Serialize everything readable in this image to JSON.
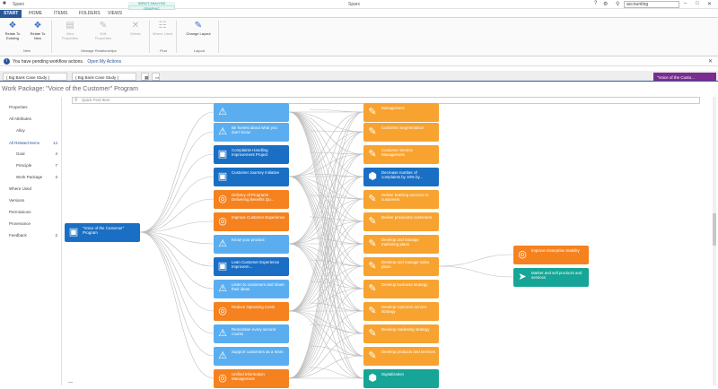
{
  "window": {
    "app_name": "Sparx",
    "center_title": "Sparx",
    "search_value": "accounting",
    "icons": [
      "help-icon",
      "settings-icon",
      "search-icon",
      "minimize-icon",
      "maximize-icon",
      "close-icon"
    ]
  },
  "ribbon_tabs": [
    "START",
    "HOME",
    "ITEMS",
    "FOLDERS",
    "VIEWS"
  ],
  "context_tab": {
    "header": "IMPACT ANALYSIS",
    "label": "GRAPHIC"
  },
  "ribbon": {
    "buttons": [
      {
        "label": "Relate To Existing",
        "icon": "relate-existing-icon",
        "enabled": true
      },
      {
        "label": "Relate To New",
        "icon": "relate-new-icon",
        "enabled": true
      },
      {
        "label": "View Properties",
        "icon": "view-properties-icon",
        "enabled": false
      },
      {
        "label": "Edit Properties",
        "icon": "edit-properties-icon",
        "enabled": false
      },
      {
        "label": "Delete",
        "icon": "delete-icon",
        "enabled": false
      },
      {
        "label": "Where Used",
        "icon": "where-used-icon",
        "enabled": false
      },
      {
        "label": "Change Layout",
        "icon": "change-layout-icon",
        "enabled": true
      }
    ],
    "groups": [
      "New",
      "Manage Relationships",
      "Find",
      "Layout"
    ]
  },
  "infobar": {
    "message": "You have pending workflow actions.",
    "link": "Open My Actions"
  },
  "doc_tabs": [
    {
      "label": "( Big Bank Case Study )",
      "active": false
    },
    {
      "label": "( Big Bank Case Study )",
      "active": false
    },
    {
      "label": "",
      "active": false
    },
    {
      "label": "",
      "active": false
    },
    {
      "label": "\"Voice of the Custo...",
      "active": true
    }
  ],
  "work_package_title": "Work Package: \"Voice of the Customer\" Program",
  "left_pane": [
    {
      "label": "Properties",
      "count": ""
    },
    {
      "label": "All Attributes",
      "count": ""
    },
    {
      "label": "Alloy",
      "count": ""
    },
    {
      "label": "All Related Items",
      "count": "14"
    },
    {
      "label": "Goal",
      "count": "4"
    },
    {
      "label": "Principle",
      "count": "7"
    },
    {
      "label": "Work Package",
      "count": "3"
    },
    {
      "label": "Where Used",
      "count": ""
    },
    {
      "label": "Versions",
      "count": ""
    },
    {
      "label": "Permissions",
      "count": ""
    },
    {
      "label": "Provenance",
      "count": ""
    },
    {
      "label": "Feedback",
      "count": "2"
    }
  ],
  "search_placeholder": "Quick Find Item",
  "diagram": {
    "root": {
      "label": "\"Voice of the Customer\" Program",
      "icon": "work-package-icon"
    },
    "column1": [
      {
        "label": "",
        "icon": "warning-icon",
        "color": "#5aaef0"
      },
      {
        "label": "Be honest about what you don't know",
        "icon": "warning-icon",
        "color": "#5aaef0"
      },
      {
        "label": "Complaints Handling Improvement Project",
        "icon": "work-package-icon",
        "color": "#1a6fc4"
      },
      {
        "label": "Customer Journey Initiative",
        "icon": "work-package-icon",
        "color": "#1a6fc4"
      },
      {
        "label": "Delivery of Programs Delivering Benefits Qu...",
        "icon": "goal-icon",
        "color": "#f5821f"
      },
      {
        "label": "Improve Customer Experience",
        "icon": "goal-icon",
        "color": "#f5821f"
      },
      {
        "label": "Know your product",
        "icon": "warning-icon",
        "color": "#5aaef0"
      },
      {
        "label": "Lean Customer Experience Improvem...",
        "icon": "work-package-icon",
        "color": "#1a6fc4"
      },
      {
        "label": "Listen to customers and share their ideas",
        "icon": "warning-icon",
        "color": "#5aaef0"
      },
      {
        "label": "Reduce Operating Costs",
        "icon": "goal-icon",
        "color": "#f5821f"
      },
      {
        "label": "Remember every second counts",
        "icon": "warning-icon",
        "color": "#5aaef0"
      },
      {
        "label": "Support customers as a team",
        "icon": "warning-icon",
        "color": "#5aaef0"
      },
      {
        "label": "Unified Information Management",
        "icon": "goal-icon",
        "color": "#f5821f"
      }
    ],
    "column2": [
      {
        "label": "Management",
        "icon": "task-icon",
        "color": "#f8a330"
      },
      {
        "label": "Customer Segmentation",
        "icon": "task-icon",
        "color": "#f8a330"
      },
      {
        "label": "Customer Service Management",
        "icon": "task-icon",
        "color": "#f8a330"
      },
      {
        "label": "Decrease number of complaints by 10% by...",
        "icon": "cube-icon",
        "color": "#1a6fc4"
      },
      {
        "label": "Deliver banking services to customers",
        "icon": "task-icon",
        "color": "#f8a330"
      },
      {
        "label": "Deliver provisions customers",
        "icon": "task-icon",
        "color": "#f8a330"
      },
      {
        "label": "Develop and manage marketing plans",
        "icon": "task-icon",
        "color": "#f8a330"
      },
      {
        "label": "Develop and manage sales plans",
        "icon": "task-icon",
        "color": "#f8a330"
      },
      {
        "label": "Develop business strategy",
        "icon": "task-icon",
        "color": "#f8a330"
      },
      {
        "label": "Develop customer service strategy",
        "icon": "task-icon",
        "color": "#f8a330"
      },
      {
        "label": "Develop marketing strategy",
        "icon": "task-icon",
        "color": "#f8a330"
      },
      {
        "label": "Develop products and services",
        "icon": "task-icon",
        "color": "#f8a330"
      },
      {
        "label": "Digitalization",
        "icon": "cube-icon",
        "color": "#16a596"
      }
    ],
    "column3": [
      {
        "label": "Improve Enterprise Stability",
        "icon": "goal-icon",
        "color": "#f5821f"
      },
      {
        "label": "Market and sell products and services",
        "icon": "chevron-icon",
        "color": "#16a596"
      }
    ]
  },
  "zoom_label": "—"
}
